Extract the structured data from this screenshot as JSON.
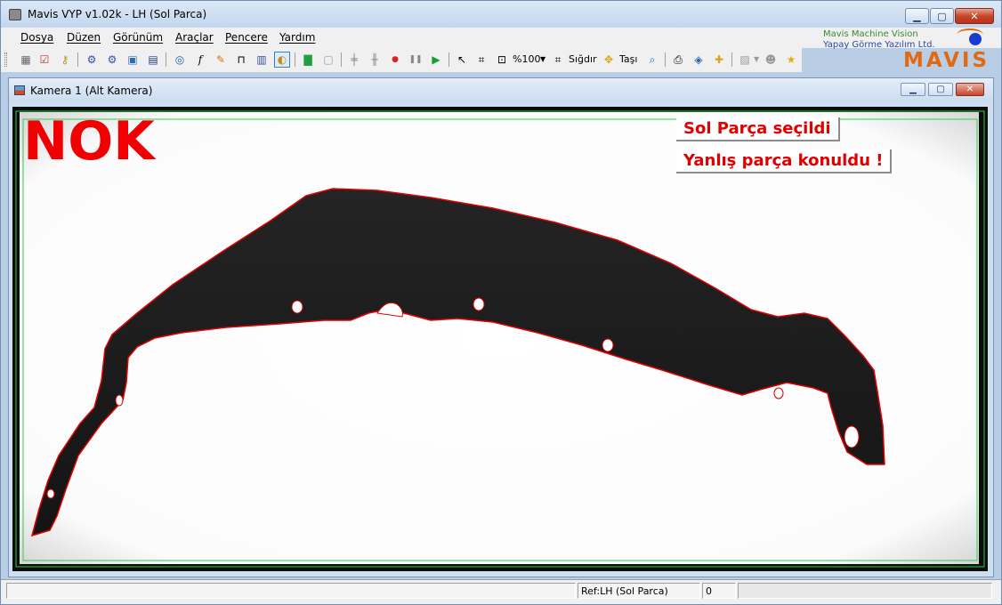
{
  "window": {
    "title": "Mavis VYP v1.02k - LH (Sol Parca)",
    "buttons": {
      "minimize": "▁",
      "maximize": "▢",
      "close": "✕"
    }
  },
  "menu": {
    "items": [
      "Dosya",
      "Düzen",
      "Görünüm",
      "Araçlar",
      "Pencere",
      "Yardım"
    ]
  },
  "logo": {
    "line1": "Mavis Machine Vision",
    "line2": "Yapay Görme Yazılım Ltd.",
    "mark": "MAVIS"
  },
  "toolbar": {
    "zoom_label": "%100",
    "fit_label": "Sığdır",
    "move_label": "Taşı"
  },
  "child_window": {
    "title": "Kamera 1 (Alt Kamera)"
  },
  "inspection": {
    "result": "NOK",
    "messages": [
      "Sol Parça seçildi",
      "Yanlış parça konuldu !"
    ],
    "colors": {
      "result": "#f00000",
      "outline": "#e00000",
      "roi": "#2ecc4a"
    }
  },
  "statusbar": {
    "ref": "Ref:LH (Sol Parca)",
    "count": "0"
  }
}
